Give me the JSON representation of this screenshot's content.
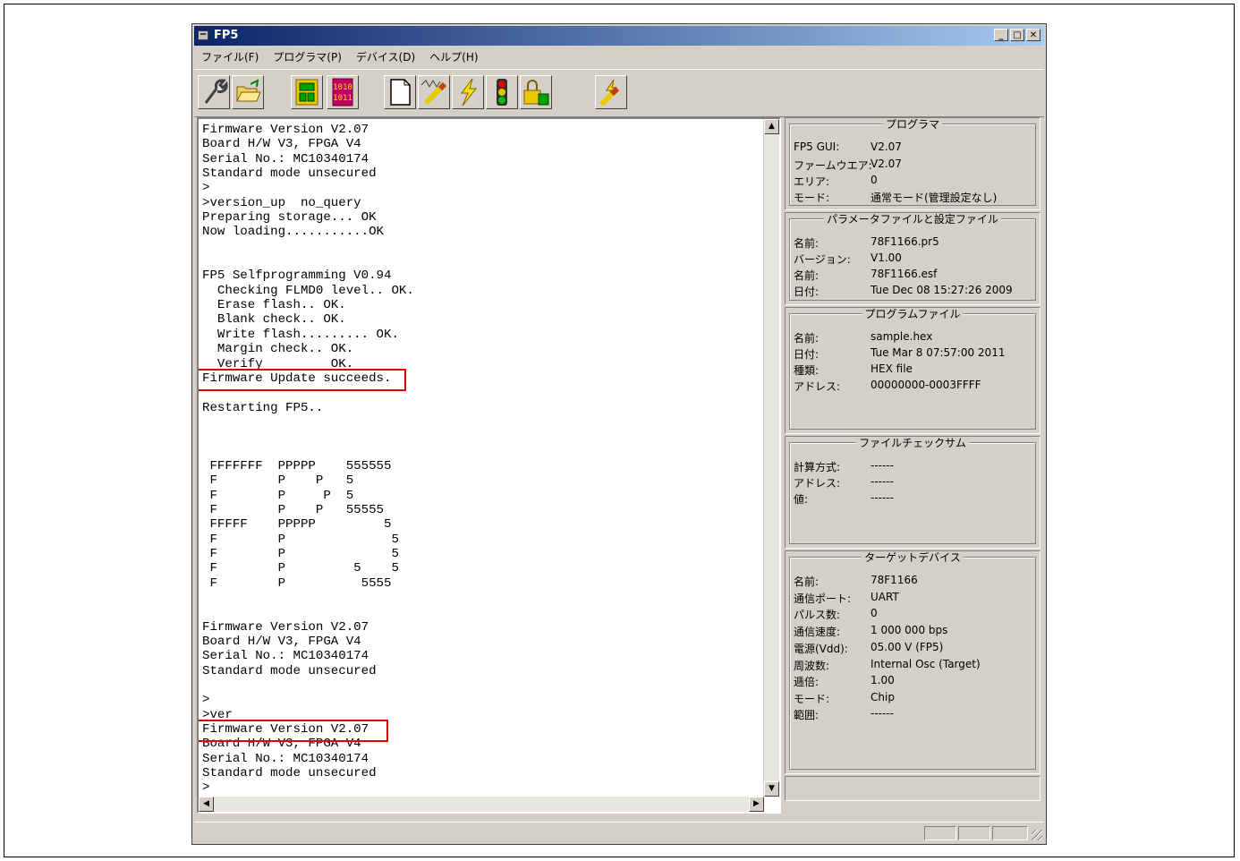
{
  "window": {
    "title": "FP5",
    "minimize": "_",
    "maximize": "□",
    "close": "✕"
  },
  "menu": [
    "ファイル(F)",
    "プログラマ(P)",
    "デバイス(D)",
    "ヘルプ(H)"
  ],
  "toolbar": [
    "setup",
    "open-file",
    "chip-blank",
    "binary-1010",
    "page-blank",
    "signal-wave",
    "lightning",
    "traffic-light",
    "security-lock",
    "auto-procedure"
  ],
  "console": {
    "lines": [
      "Firmware Version V2.07",
      "Board H/W V3, FPGA V4",
      "Serial No.: MC10340174",
      "Standard mode unsecured",
      ">",
      ">version_up  no_query",
      "Preparing storage... OK",
      "Now loading...........OK",
      "",
      "",
      "FP5 Selfprogramming V0.94",
      "  Checking FLMD0 level.. OK.",
      "  Erase flash.. OK.",
      "  Blank check.. OK.",
      "  Write flash......... OK.",
      "  Margin check.. OK.",
      "  Verify         OK.",
      "Firmware Update succeeds.",
      "",
      "Restarting FP5..",
      "",
      "",
      "",
      " FFFFFFF  PPPPP    555555",
      " F        P    P   5",
      " F        P     P  5",
      " F        P    P   55555",
      " FFFFF    PPPPP         5",
      " F        P              5",
      " F        P              5",
      " F        P         5    5",
      " F        P          5555",
      "",
      "",
      "Firmware Version V2.07",
      "Board H/W V3, FPGA V4",
      "Serial No.: MC10340174",
      "Standard mode unsecured",
      "",
      ">",
      ">ver",
      "Firmware Version V2.07",
      "Board H/W V3, FPGA V4",
      "Serial No.: MC10340174",
      "Standard mode unsecured",
      ">"
    ]
  },
  "programmer": {
    "title": "プログラマ",
    "rows": [
      {
        "k": "FP5 GUI:",
        "v": "V2.07"
      },
      {
        "k": "ファームウエア:",
        "v": "V2.07"
      },
      {
        "k": "エリア:",
        "v": "0"
      },
      {
        "k": "モード:",
        "v": "通常モード(管理設定なし)"
      }
    ]
  },
  "param": {
    "title": "パラメータファイルと設定ファイル",
    "rows": [
      {
        "k": "名前:",
        "v": "78F1166.pr5"
      },
      {
        "k": "バージョン:",
        "v": "V1.00"
      },
      {
        "k": "名前:",
        "v": "78F1166.esf"
      },
      {
        "k": "日付:",
        "v": "Tue Dec 08 15:27:26 2009"
      }
    ]
  },
  "progfile": {
    "title": "プログラムファイル",
    "rows": [
      {
        "k": "名前:",
        "v": "sample.hex"
      },
      {
        "k": "日付:",
        "v": "Tue Mar  8 07:57:00 2011"
      },
      {
        "k": "種類:",
        "v": "HEX file"
      },
      {
        "k": "アドレス:",
        "v": "00000000-0003FFFF"
      }
    ]
  },
  "checksum": {
    "title": "ファイルチェックサム",
    "rows": [
      {
        "k": "計算方式:",
        "v": "------"
      },
      {
        "k": "アドレス:",
        "v": "------"
      },
      {
        "k": "値:",
        "v": "------"
      }
    ]
  },
  "target": {
    "title": "ターゲットデバイス",
    "rows": [
      {
        "k": "名前:",
        "v": "78F1166"
      },
      {
        "k": "通信ポート:",
        "v": "UART"
      },
      {
        "k": "パルス数:",
        "v": "0"
      },
      {
        "k": "通信速度:",
        "v": "1 000 000 bps"
      },
      {
        "k": "電源(Vdd):",
        "v": "05.00 V (FP5)"
      },
      {
        "k": "周波数:",
        "v": "Internal Osc (Target)"
      },
      {
        "k": "逓倍:",
        "v": "1.00"
      },
      {
        "k": "モード:",
        "v": "Chip"
      },
      {
        "k": "範囲:",
        "v": "------"
      }
    ]
  },
  "colors": {
    "highlight": "#e00000",
    "title_start": "#0a246a",
    "title_end": "#a6caf0",
    "face": "#d4d0c8"
  }
}
